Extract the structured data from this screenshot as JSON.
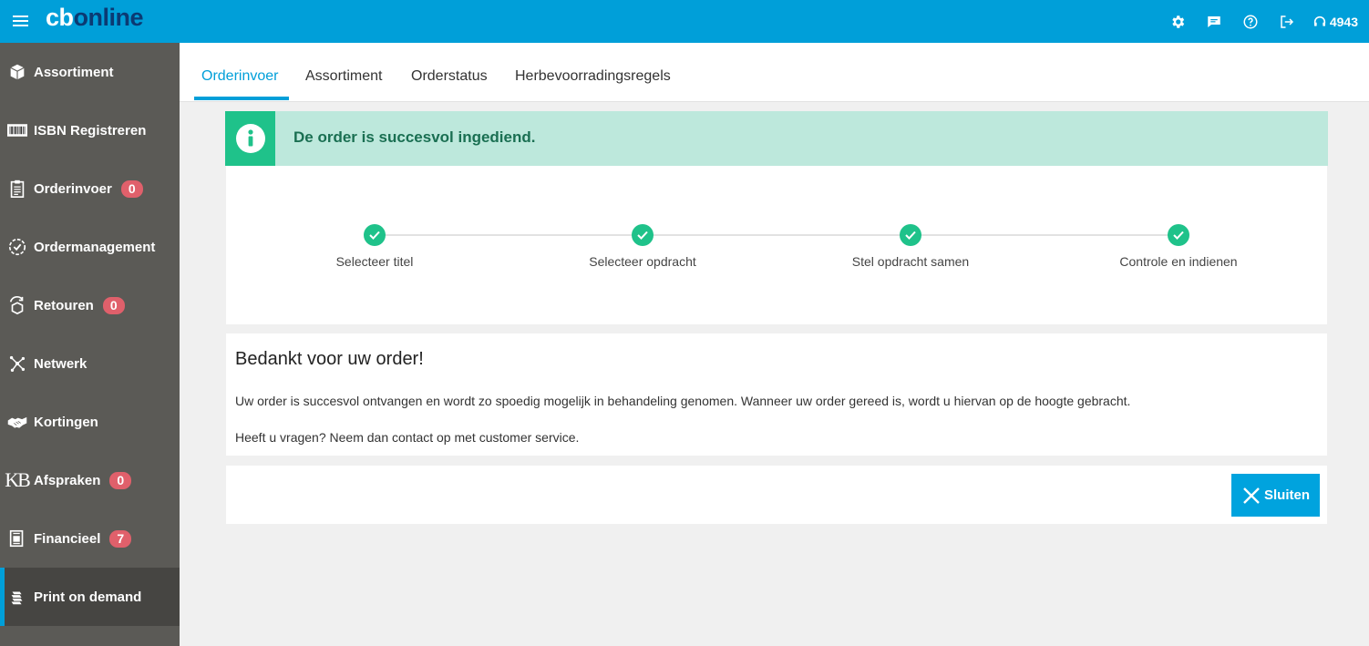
{
  "header": {
    "logo_cb": "cb",
    "logo_online": "online",
    "support_number": "4943",
    "icons": [
      "gear-icon",
      "chat-icon",
      "help-icon",
      "logout-icon",
      "headset-icon"
    ]
  },
  "sidebar": {
    "items": [
      {
        "label": "Assortiment",
        "icon": "box-icon"
      },
      {
        "label": "ISBN Registreren",
        "icon": "barcode-icon"
      },
      {
        "label": "Orderinvoer",
        "icon": "clipboard-icon",
        "badge": "0"
      },
      {
        "label": "Ordermanagement",
        "icon": "check-circle-icon"
      },
      {
        "label": "Retouren",
        "icon": "return-box-icon",
        "badge": "0"
      },
      {
        "label": "Netwerk",
        "icon": "network-icon"
      },
      {
        "label": "Kortingen",
        "icon": "handshake-icon"
      },
      {
        "label": "Afspraken",
        "icon": "kb-logo-icon",
        "icon_text": "KB",
        "badge": "0"
      },
      {
        "label": "Financieel",
        "icon": "invoice-icon",
        "badge": "7"
      },
      {
        "label": "Print on demand",
        "icon": "print-stack-icon",
        "active": true
      }
    ]
  },
  "tabs": [
    {
      "label": "Orderinvoer",
      "active": true
    },
    {
      "label": "Assortiment"
    },
    {
      "label": "Orderstatus"
    },
    {
      "label": "Herbevoorradingsregels"
    }
  ],
  "alert": {
    "text": "De order is succesvol ingediend.",
    "icon": "info-icon",
    "color": "#1fc28a"
  },
  "steps": [
    {
      "label": "Selecteer titel",
      "done": true
    },
    {
      "label": "Selecteer opdracht",
      "done": true
    },
    {
      "label": "Stel opdracht samen",
      "done": true
    },
    {
      "label": "Controle en indienen",
      "done": true
    }
  ],
  "thanks": {
    "title": "Bedankt voor uw order!",
    "paragraph1": "Uw order is succesvol ontvangen en wordt zo spoedig mogelijk in behandeling genomen. Wanneer uw order gereed is, wordt u hiervan op de hoogte gebracht.",
    "paragraph2": "Heeft u vragen? Neem dan contact op met customer service."
  },
  "footer": {
    "close_label": "Sluiten"
  },
  "colors": {
    "brand_blue": "#009fd9",
    "sidebar": "#5b5a56",
    "badge": "#e0606b",
    "success": "#1fc28a"
  }
}
